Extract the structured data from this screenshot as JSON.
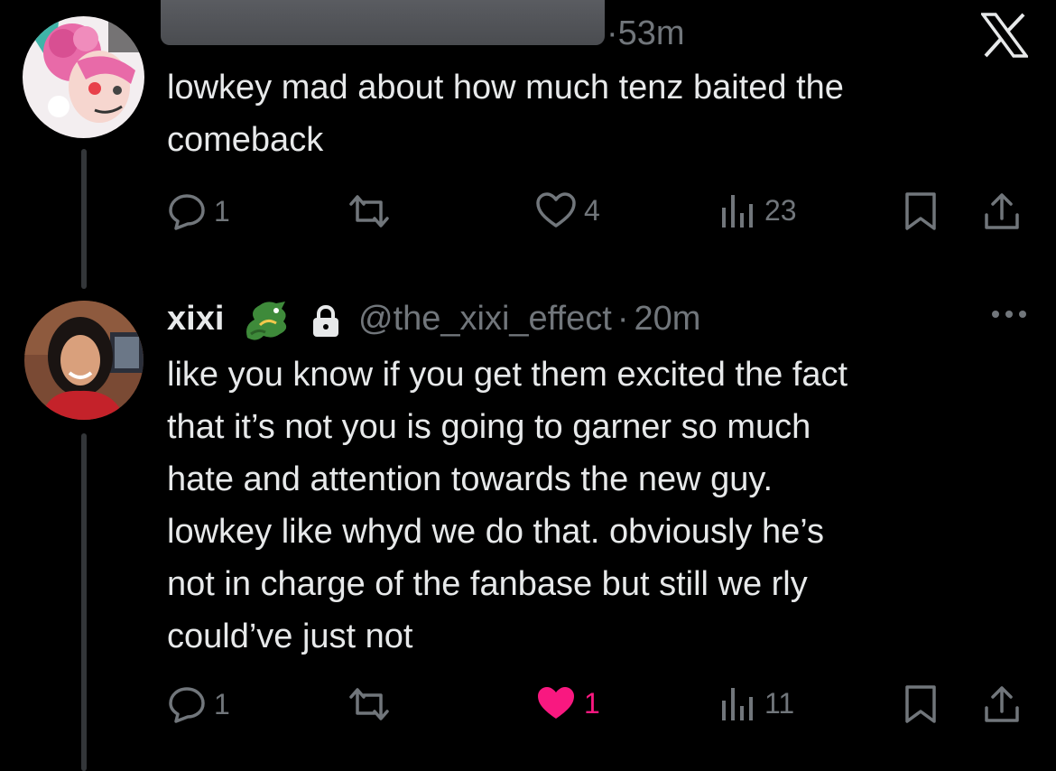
{
  "tweet1": {
    "time": "53m",
    "text_line1": "lowkey mad about how much tenz baited the",
    "text_line2": "comeback",
    "actions": {
      "replies": "1",
      "likes": "4",
      "views": "23"
    }
  },
  "tweet2": {
    "display_name": "xixi",
    "handle": "@the_xixi_effect",
    "time": "20m",
    "text_lines": [
      "like you know if you get them excited the fact",
      "that it’s not you is going to garner so much",
      "hate and attention towards the new guy.",
      "lowkey like whyd we do that. obviously he’s",
      "not in charge of the fanbase but still we rly",
      "could’ve just not"
    ],
    "actions": {
      "replies": "1",
      "likes": "1",
      "views": "11"
    }
  },
  "icons": [
    "reply-icon",
    "retweet-icon",
    "like-icon",
    "views-icon",
    "bookmark-icon",
    "share-icon",
    "x-logo-icon",
    "lock-icon",
    "dragon-emoji-icon",
    "more-icon"
  ],
  "colors": {
    "background": "#000000",
    "text": "#e7e9ea",
    "secondary": "#71767b",
    "like_active": "#f91880",
    "thread_line": "#333639"
  }
}
